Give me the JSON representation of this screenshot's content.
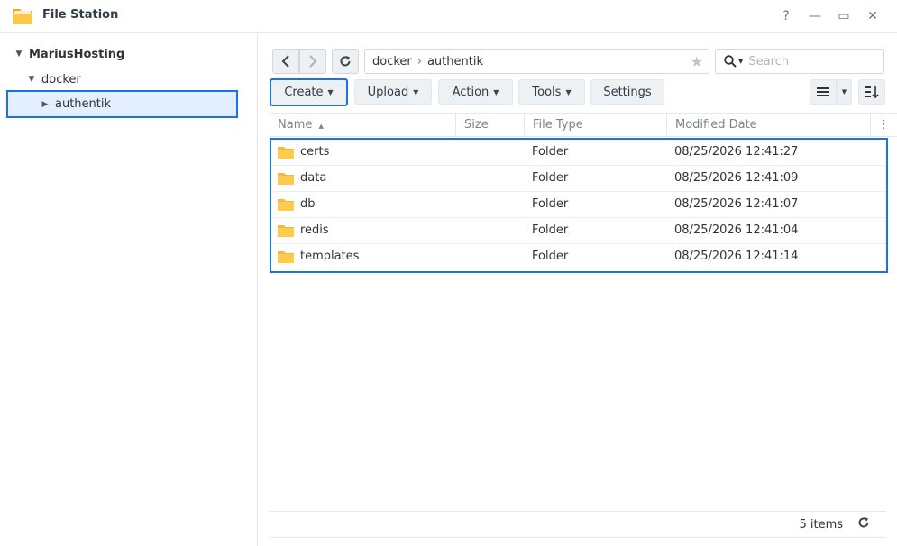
{
  "window": {
    "title": "File Station",
    "help": "?",
    "minimize": "—",
    "maximize": "▭",
    "close": "✕"
  },
  "sidebar": {
    "root": "MariusHosting",
    "items": [
      {
        "label": "docker"
      },
      {
        "label": "authentik"
      }
    ]
  },
  "path": {
    "segments": [
      "docker",
      "authentik"
    ],
    "separator": "›"
  },
  "search": {
    "placeholder": "Search"
  },
  "toolbar": {
    "create": "Create",
    "upload": "Upload",
    "action": "Action",
    "tools": "Tools",
    "settings": "Settings"
  },
  "table": {
    "columns": [
      "Name",
      "Size",
      "File Type",
      "Modified Date"
    ],
    "sort_indicator": "▲",
    "rows": [
      {
        "name": "certs",
        "size": "",
        "type": "Folder",
        "modified": "08/25/2026 12:41:27"
      },
      {
        "name": "data",
        "size": "",
        "type": "Folder",
        "modified": "08/25/2026 12:41:09"
      },
      {
        "name": "db",
        "size": "",
        "type": "Folder",
        "modified": "08/25/2026 12:41:07"
      },
      {
        "name": "redis",
        "size": "",
        "type": "Folder",
        "modified": "08/25/2026 12:41:04"
      },
      {
        "name": "templates",
        "size": "",
        "type": "Folder",
        "modified": "08/25/2026 12:41:14"
      }
    ]
  },
  "footer": {
    "count": "5 items"
  },
  "colors": {
    "accent": "#1b72e8",
    "folder": "#f8c146",
    "selected_bg": "#e3efff"
  }
}
